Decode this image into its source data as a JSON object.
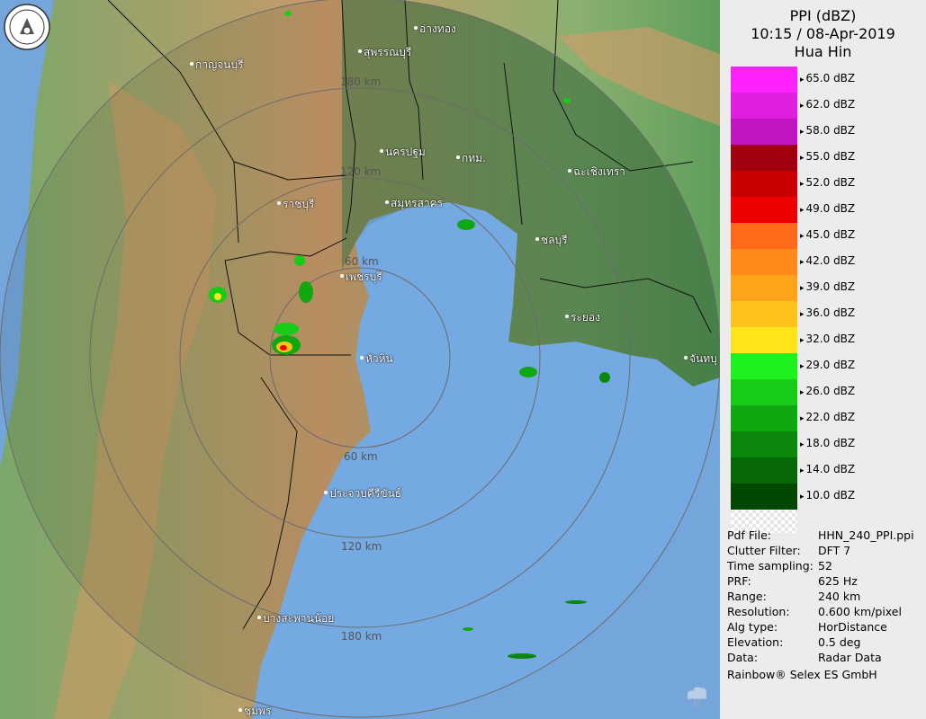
{
  "panel": {
    "title": "PPI (dBZ)",
    "datetime": "10:15 / 08-Apr-2019",
    "station": "Hua Hin"
  },
  "scale": [
    {
      "label": "65.0 dBZ",
      "color": "#ff22ff"
    },
    {
      "label": "62.0 dBZ",
      "color": "#e01ee0"
    },
    {
      "label": "58.0 dBZ",
      "color": "#c015c0"
    },
    {
      "label": "55.0 dBZ",
      "color": "#a00010"
    },
    {
      "label": "52.0 dBZ",
      "color": "#c80000"
    },
    {
      "label": "49.0 dBZ",
      "color": "#ee0000"
    },
    {
      "label": "45.0 dBZ",
      "color": "#ff6a1a"
    },
    {
      "label": "42.0 dBZ",
      "color": "#ff8a1a"
    },
    {
      "label": "39.0 dBZ",
      "color": "#ffa31a"
    },
    {
      "label": "36.0 dBZ",
      "color": "#ffc21a"
    },
    {
      "label": "32.0 dBZ",
      "color": "#ffe41a"
    },
    {
      "label": "29.0 dBZ",
      "color": "#1ef21e"
    },
    {
      "label": "26.0 dBZ",
      "color": "#16cc16"
    },
    {
      "label": "22.0 dBZ",
      "color": "#10a810"
    },
    {
      "label": "18.0 dBZ",
      "color": "#0b880b"
    },
    {
      "label": "14.0 dBZ",
      "color": "#066806"
    },
    {
      "label": "10.0 dBZ",
      "color": "#024802"
    }
  ],
  "info": [
    {
      "key": "Pdf File:",
      "value": "HHN_240_PPI.ppi"
    },
    {
      "key": "Clutter Filter:",
      "value": "DFT 7"
    },
    {
      "key": "Time sampling:",
      "value": "52"
    },
    {
      "key": "PRF:",
      "value": "625 Hz"
    },
    {
      "key": "Range:",
      "value": "240 km"
    },
    {
      "key": "Resolution:",
      "value": "0.600 km/pixel"
    },
    {
      "key": "Alg type:",
      "value": "HorDistance"
    },
    {
      "key": "Elevation:",
      "value": "0.5 deg"
    },
    {
      "key": "Data:",
      "value": "Radar Data"
    }
  ],
  "footer": "Rainbow® Selex ES GmbH",
  "places": [
    {
      "name": "อ่างทอง"
    },
    {
      "name": "สุพรรณบุรี"
    },
    {
      "name": "กาญจนบุรี"
    },
    {
      "name": "นครปฐม"
    },
    {
      "name": "กทม."
    },
    {
      "name": "ฉะเชิงเทรา"
    },
    {
      "name": "ราชบุรี"
    },
    {
      "name": "สมุทรสาคร"
    },
    {
      "name": "ชลบุรี"
    },
    {
      "name": "เพชรบุรี"
    },
    {
      "name": "ระยอง"
    },
    {
      "name": "หัวหิน"
    },
    {
      "name": "จันทบุ"
    },
    {
      "name": "ประจวบคีรีขันธ์"
    },
    {
      "name": "บางสะพานน้อย"
    },
    {
      "name": "ชุมพร"
    }
  ],
  "rings": [
    "180 km",
    "120 km",
    "60 km",
    "60 km",
    "120 km",
    "180 km"
  ],
  "colors": {
    "sea": "#7fb8f5",
    "ocean_outside": "#74a6dc",
    "land_low": "#5e9e5a",
    "land_high": "#d9a26b",
    "overlay": "#3b6e3b"
  }
}
